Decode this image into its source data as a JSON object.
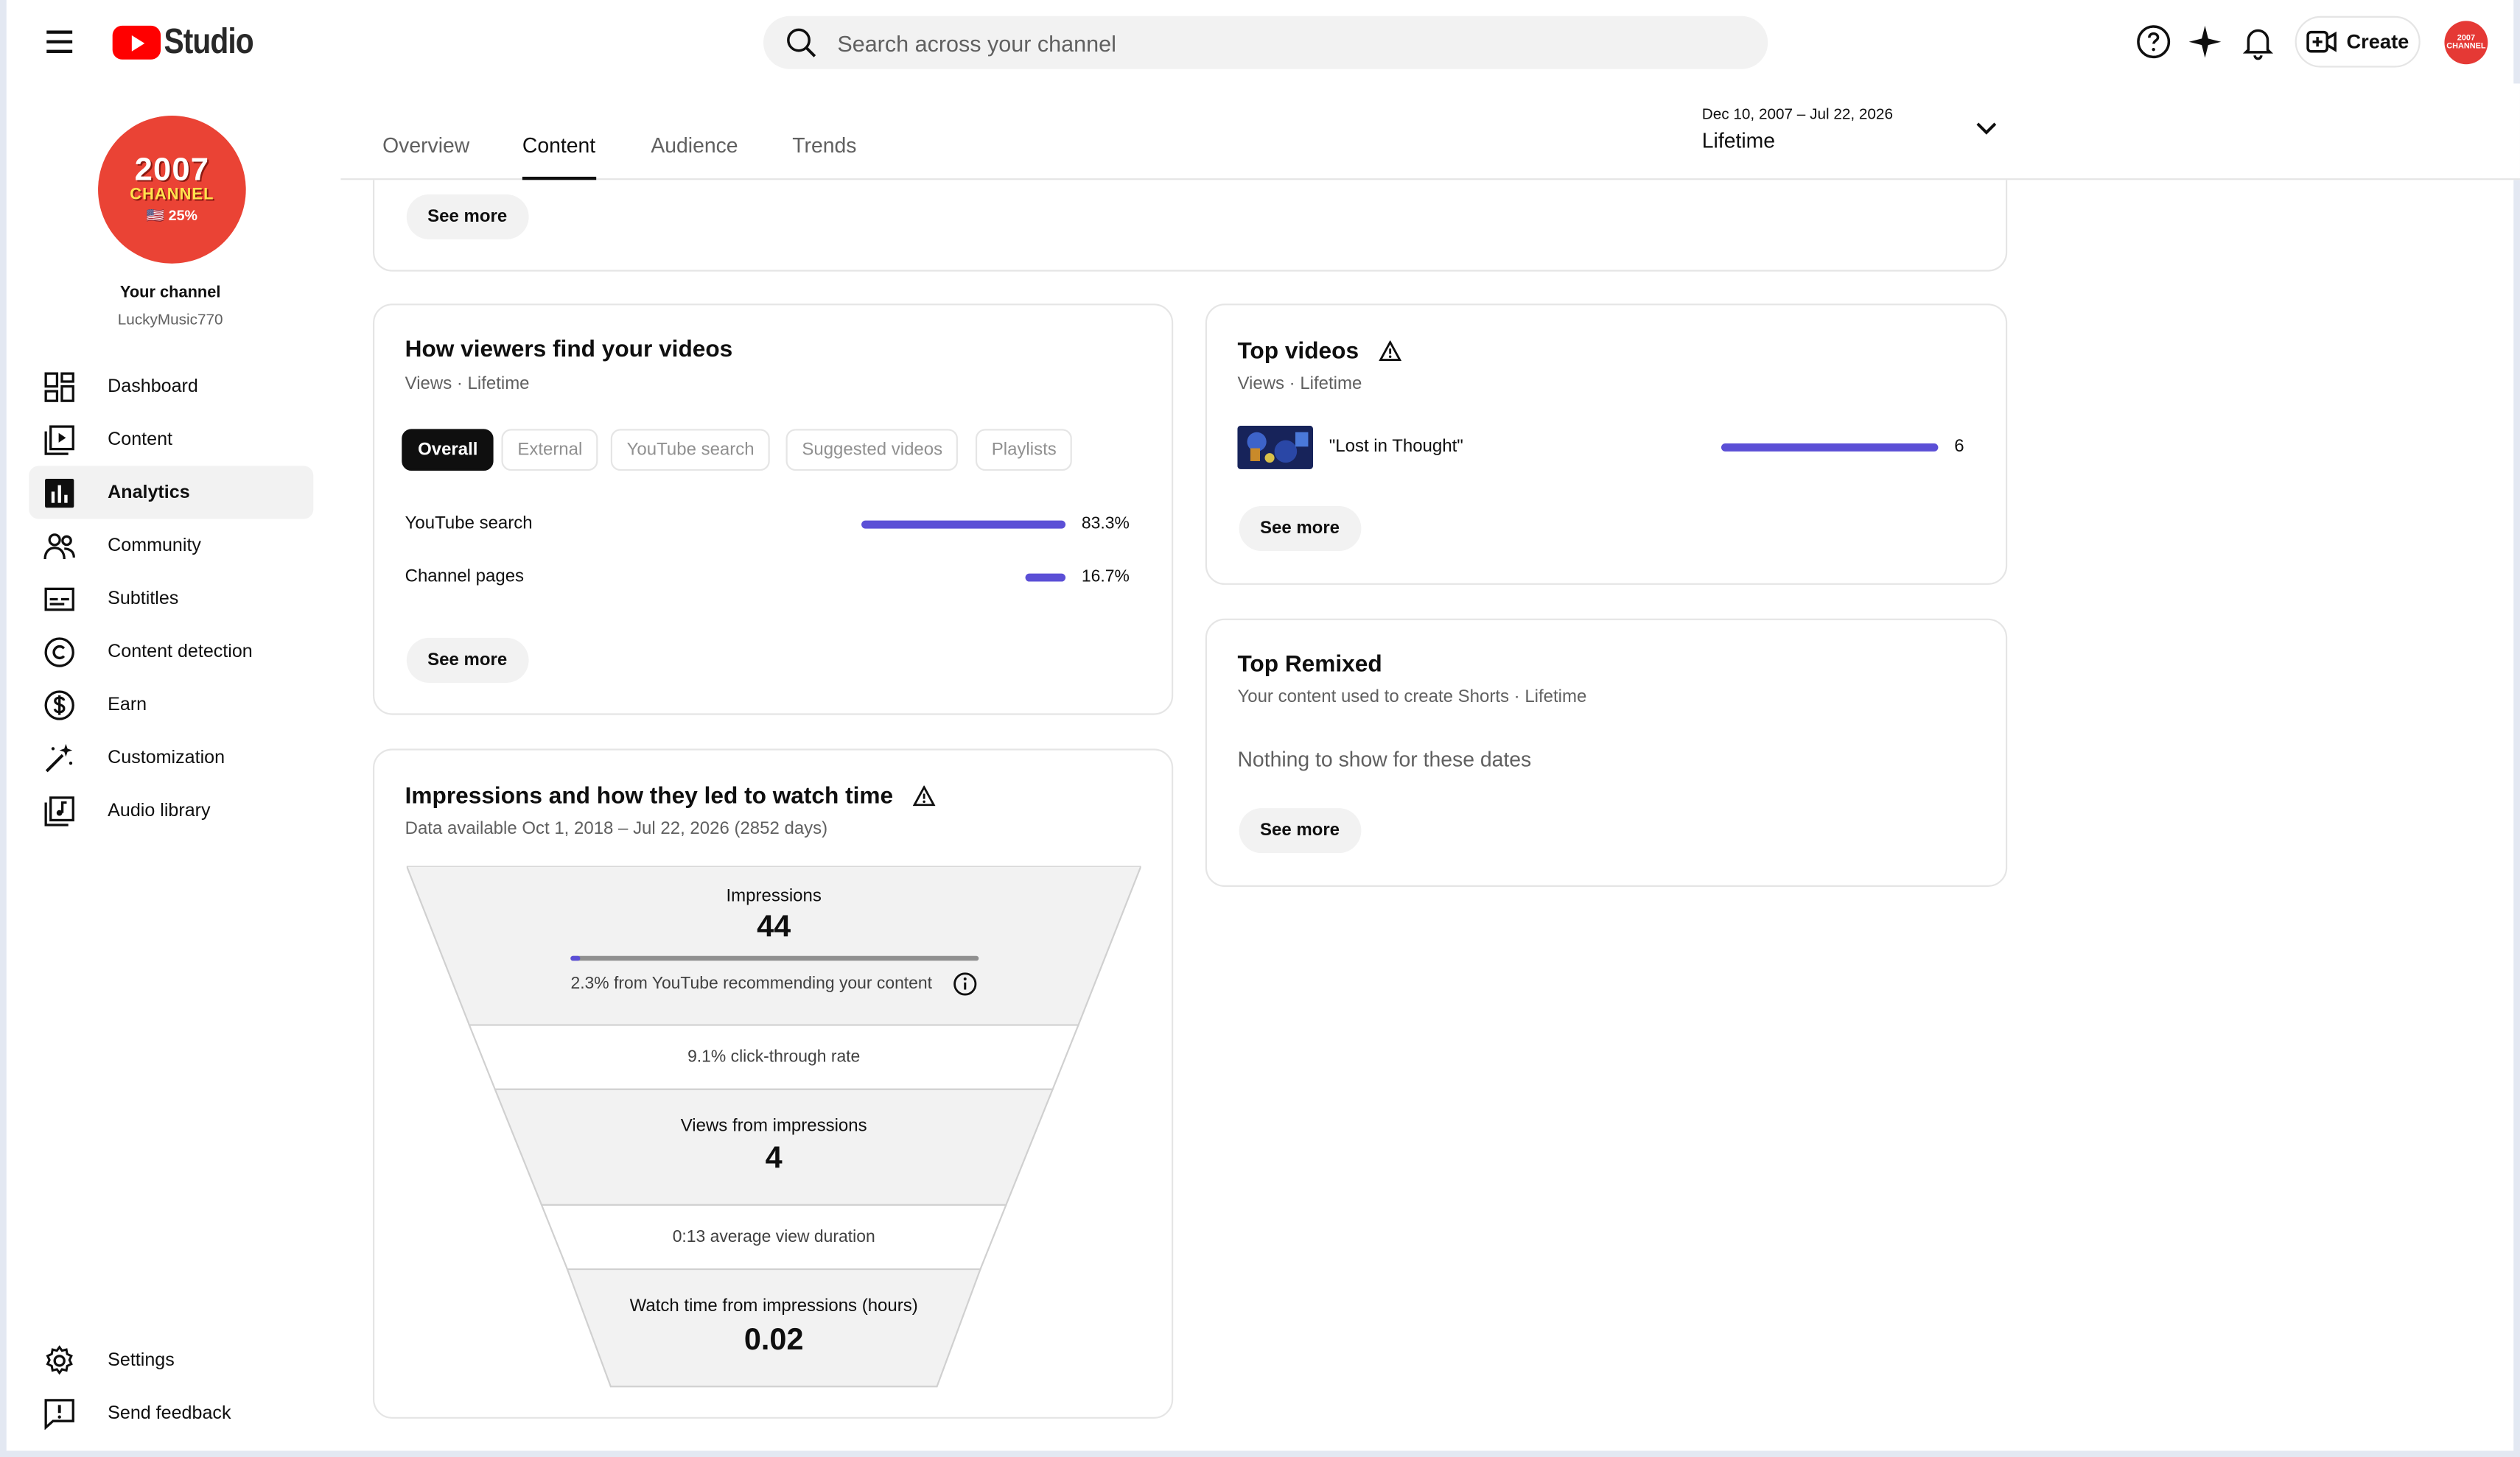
{
  "app": {
    "title": "Studio"
  },
  "search": {
    "placeholder": "Search across your channel"
  },
  "header": {
    "create_label": "Create",
    "avatar_text": "2007 CHANNEL"
  },
  "channel": {
    "avatar_line1": "2007",
    "avatar_line2": "CHANNEL",
    "avatar_line3": "🇺🇸 25%",
    "label": "Your channel",
    "name": "LuckyMusic770"
  },
  "sidebar": {
    "items": [
      {
        "label": "Dashboard",
        "icon": "dashboard-icon"
      },
      {
        "label": "Content",
        "icon": "content-icon"
      },
      {
        "label": "Analytics",
        "icon": "analytics-icon",
        "active": true
      },
      {
        "label": "Community",
        "icon": "community-icon"
      },
      {
        "label": "Subtitles",
        "icon": "subtitles-icon"
      },
      {
        "label": "Content detection",
        "icon": "copyright-icon"
      },
      {
        "label": "Earn",
        "icon": "dollar-icon"
      },
      {
        "label": "Customization",
        "icon": "magic-wand-icon"
      },
      {
        "label": "Audio library",
        "icon": "audio-library-icon"
      }
    ],
    "bottom": [
      {
        "label": "Settings",
        "icon": "gear-icon"
      },
      {
        "label": "Send feedback",
        "icon": "feedback-icon"
      }
    ]
  },
  "tabs": [
    {
      "label": "Overview"
    },
    {
      "label": "Content",
      "active": true
    },
    {
      "label": "Audience"
    },
    {
      "label": "Trends"
    }
  ],
  "date_range": {
    "dates": "Dec 10, 2007 – Jul 22, 2026",
    "label": "Lifetime"
  },
  "top_card": {
    "see_more": "See more"
  },
  "traffic": {
    "title": "How viewers find your videos",
    "subtitle": "Views · Lifetime",
    "chips": [
      "Overall",
      "External",
      "YouTube search",
      "Suggested videos",
      "Playlists"
    ],
    "rows": [
      {
        "label": "YouTube search",
        "value": "83.3%",
        "pct": 83.3
      },
      {
        "label": "Channel pages",
        "value": "16.7%",
        "pct": 16.7
      }
    ],
    "see_more": "See more"
  },
  "top_videos": {
    "title": "Top videos",
    "subtitle": "Views · Lifetime",
    "items": [
      {
        "title": "\"Lost in Thought\"",
        "value": "6",
        "fraction": 1.0
      }
    ],
    "see_more": "See more"
  },
  "top_remixed": {
    "title": "Top Remixed",
    "subtitle": "Your content used to create Shorts · Lifetime",
    "empty": "Nothing to show for these dates",
    "see_more": "See more"
  },
  "impressions": {
    "title": "Impressions and how they led to watch time",
    "subtitle": "Data available Oct 1, 2018 – Jul 22, 2026 (2852 days)",
    "impressions_label": "Impressions",
    "impressions_value": "44",
    "recommend_fraction": 0.023,
    "recommend_text": "2.3% from YouTube recommending your content",
    "ctr_text": "9.1% click-through rate",
    "views_label": "Views from impressions",
    "views_value": "4",
    "avd_text": "0:13 average view duration",
    "watch_label": "Watch time from impressions (hours)",
    "watch_value": "0.02"
  },
  "colors": {
    "accent": "#5b4fd6",
    "brand": "#ff0000",
    "avatar": "#ea4335"
  }
}
